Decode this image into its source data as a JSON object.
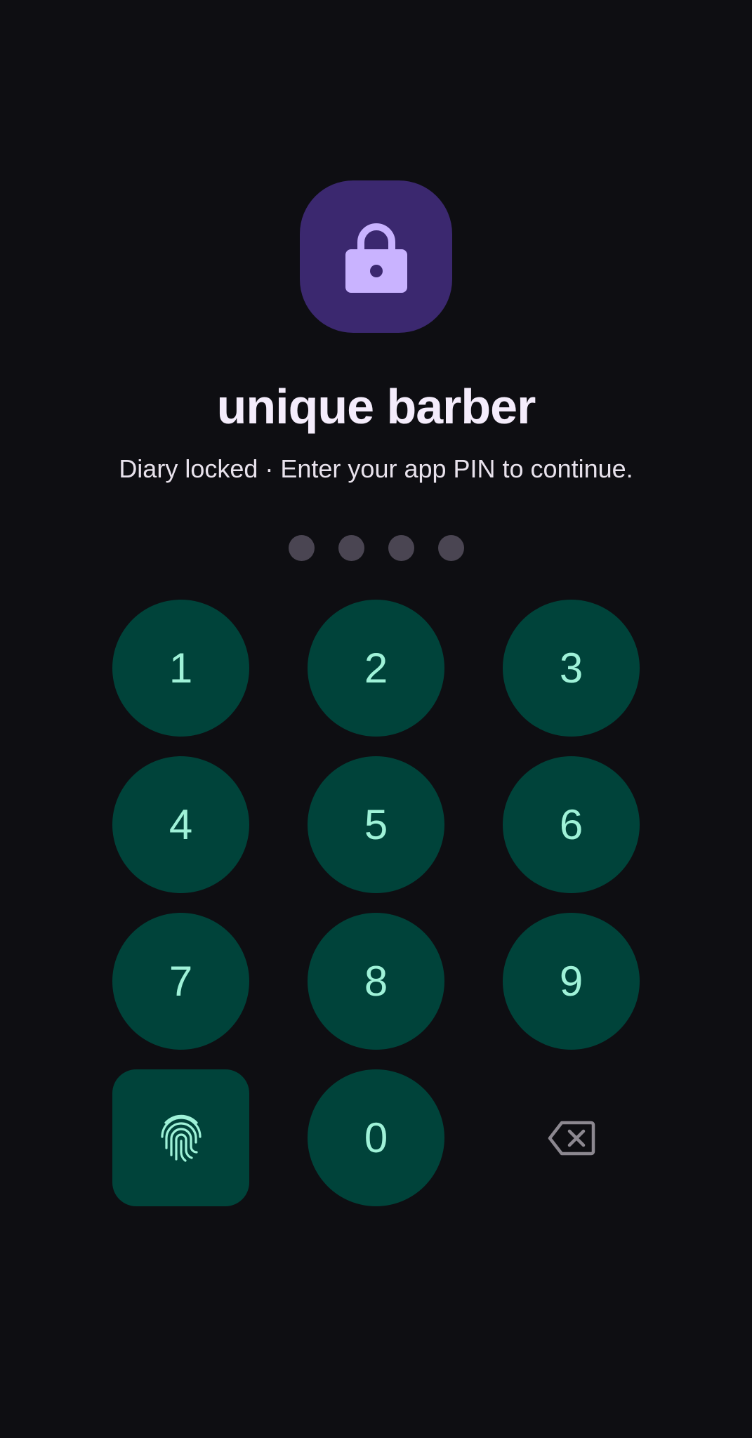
{
  "app": {
    "title": "unique barber",
    "subtitle": "Diary locked · Enter your app PIN to continue."
  },
  "lock_icon": {
    "icon": "lock-icon",
    "tile_color": "#3b286f",
    "icon_color": "#c9b3ff"
  },
  "pin": {
    "length": 4,
    "entered": 0
  },
  "keypad": {
    "keys": [
      {
        "label": "1",
        "name": "key-1"
      },
      {
        "label": "2",
        "name": "key-2"
      },
      {
        "label": "3",
        "name": "key-3"
      },
      {
        "label": "4",
        "name": "key-4"
      },
      {
        "label": "5",
        "name": "key-5"
      },
      {
        "label": "6",
        "name": "key-6"
      },
      {
        "label": "7",
        "name": "key-7"
      },
      {
        "label": "8",
        "name": "key-8"
      },
      {
        "label": "9",
        "name": "key-9"
      },
      {
        "label": "0",
        "name": "key-0"
      }
    ],
    "fingerprint_icon": "fingerprint-icon",
    "backspace_icon": "backspace-icon"
  },
  "colors": {
    "background": "#0e0e12",
    "key_background": "#00433a",
    "key_text": "#9ff2d8",
    "dot_empty": "#4a4552"
  }
}
